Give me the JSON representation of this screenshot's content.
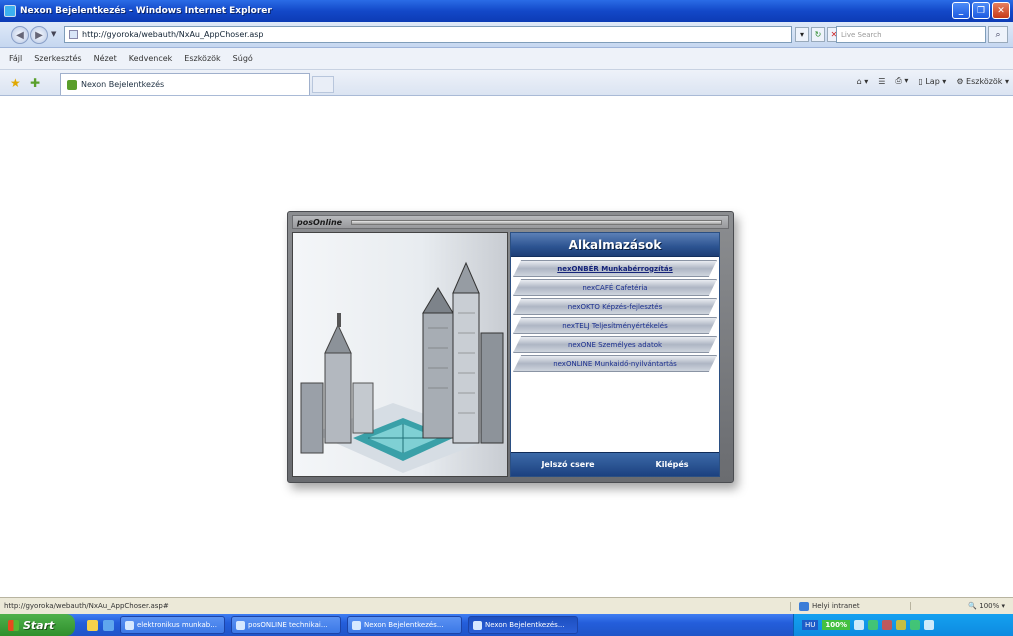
{
  "window": {
    "title": "Nexon Bejelentkezés - Windows Internet Explorer"
  },
  "browser": {
    "url": "http://gyoroka/webauth/NxAu_AppChoser.asp",
    "search_placeholder": "Live Search",
    "menu": [
      "Fájl",
      "Szerkesztés",
      "Nézet",
      "Kedvencek",
      "Eszközök",
      "Súgó"
    ],
    "tab_title": "Nexon Bejelentkezés",
    "toolbar": {
      "page_label": "Lap",
      "tools_label": "Eszközök"
    }
  },
  "app": {
    "brand": "posOnline",
    "menu_title": "Alkalmazások",
    "items": [
      "nexONBÉR Munkabérrogzítás",
      "nexCAFÉ Cafetéria",
      "nexOKTO Képzés-fejlesztés",
      "nexTELJ Teljesítményértékelés",
      "nexONE Személyes adatok",
      "nexONLINE Munkaidő-nyilvántartás"
    ],
    "footer": {
      "password_change": "Jelszó csere",
      "logout": "Kilépés"
    }
  },
  "status": {
    "text": "http://gyoroka/webauth/NxAu_AppChoser.asp#",
    "zone": "Helyi intranet",
    "zoom": "100%"
  },
  "taskbar": {
    "start": "Start",
    "tasks": [
      "elektronikus munkab...",
      "posONLINE technikai...",
      "Nexon Bejelentkezés...",
      "Nexon Bejelentkezés..."
    ],
    "lang": "HU",
    "battery": "100%"
  },
  "colors": {
    "accent": "#2c5391",
    "link": "#1b2f8f",
    "title_bar": "#1348c8"
  }
}
